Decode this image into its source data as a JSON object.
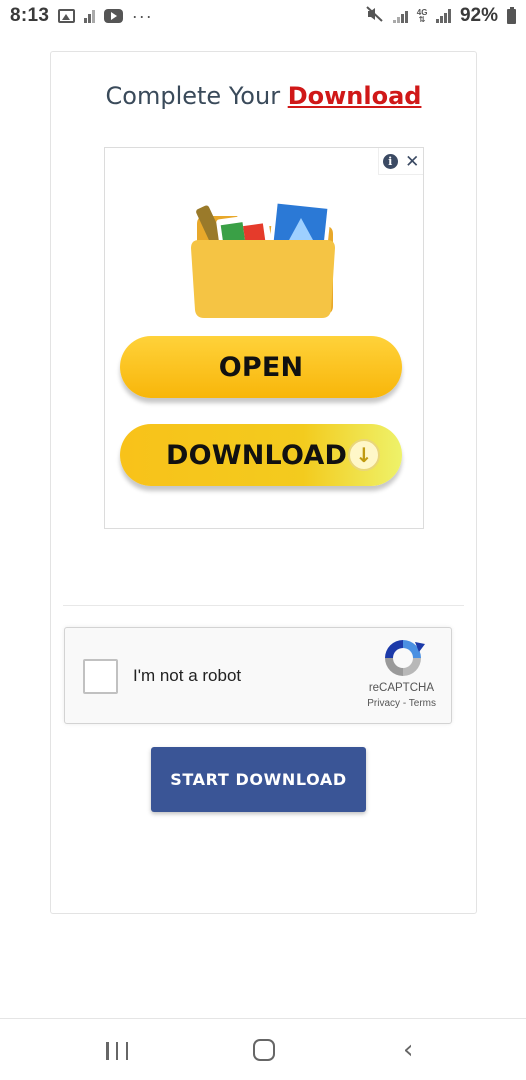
{
  "status_bar": {
    "time": "8:13",
    "overflow_dots": "···",
    "network_label": "4G",
    "battery_text": "92%"
  },
  "page": {
    "title_prefix": "Complete Your ",
    "title_highlight": "Download",
    "highlight_color": "#d01818"
  },
  "ad": {
    "info_glyph": "i",
    "close_glyph": "✕",
    "open_button": "OPEN",
    "download_button": "DOWNLOAD",
    "download_arrow": "↓"
  },
  "recaptcha": {
    "label": "I'm not a robot",
    "brand": "reCAPTCHA",
    "privacy": "Privacy",
    "separator": " - ",
    "terms": "Terms"
  },
  "start_button": {
    "label": "START DOWNLOAD",
    "color": "#3a5596"
  },
  "nav": {
    "back_glyph": "‹"
  }
}
